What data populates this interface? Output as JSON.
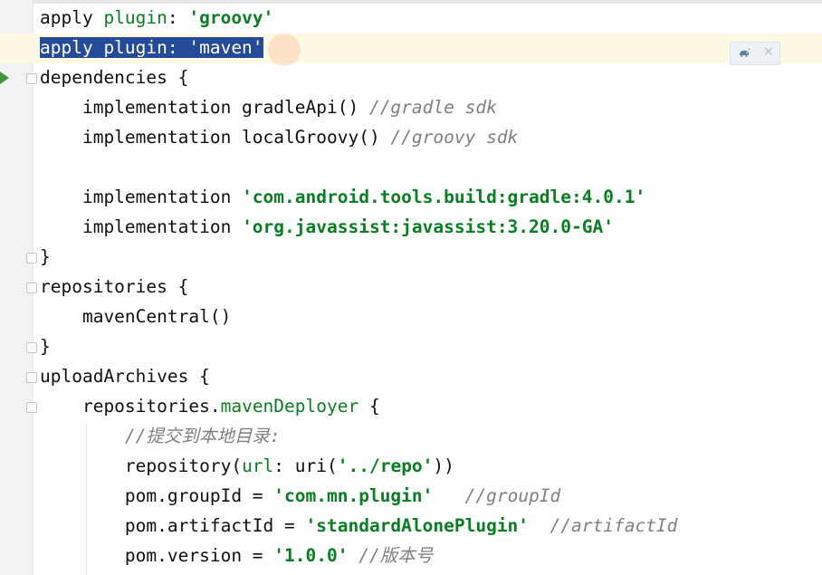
{
  "lines": [
    {
      "tokens": [
        {
          "t": "apply ",
          "c": "kw"
        },
        {
          "t": "plugin",
          "c": "dsl"
        },
        {
          "t": ": ",
          "c": "kw"
        },
        {
          "t": "'groovy'",
          "c": "str"
        }
      ]
    },
    {
      "tokens": [
        {
          "t": "apply plugin: 'maven'",
          "c": "sel"
        }
      ]
    },
    {
      "tokens": [
        {
          "t": "dependencies {",
          "c": "kw"
        }
      ]
    },
    {
      "tokens": [
        {
          "t": "    implementation gradleApi() ",
          "c": "kw"
        },
        {
          "t": "//gradle sdk",
          "c": "cmt"
        }
      ]
    },
    {
      "tokens": [
        {
          "t": "    implementation localGroovy() ",
          "c": "kw"
        },
        {
          "t": "//groovy sdk",
          "c": "cmt"
        }
      ]
    },
    {
      "tokens": []
    },
    {
      "tokens": [
        {
          "t": "    implementation ",
          "c": "kw"
        },
        {
          "t": "'com.android.tools.build:gradle:4.0.1'",
          "c": "str"
        }
      ]
    },
    {
      "tokens": [
        {
          "t": "    implementation ",
          "c": "kw"
        },
        {
          "t": "'org.javassist:javassist:3.20.0-GA'",
          "c": "str"
        }
      ]
    },
    {
      "tokens": [
        {
          "t": "}",
          "c": "kw"
        }
      ]
    },
    {
      "tokens": [
        {
          "t": "repositories {",
          "c": "kw"
        }
      ]
    },
    {
      "tokens": [
        {
          "t": "    mavenCentral()",
          "c": "kw"
        }
      ]
    },
    {
      "tokens": [
        {
          "t": "}",
          "c": "kw"
        }
      ]
    },
    {
      "tokens": [
        {
          "t": "uploadArchives {",
          "c": "kw"
        }
      ]
    },
    {
      "tokens": [
        {
          "t": "    repositories.",
          "c": "kw"
        },
        {
          "t": "mavenDeployer",
          "c": "dsl"
        },
        {
          "t": " {",
          "c": "kw"
        }
      ]
    },
    {
      "tokens": [
        {
          "t": "        ",
          "c": "kw"
        },
        {
          "t": "//提交到本地目录:",
          "c": "cmt"
        }
      ]
    },
    {
      "tokens": [
        {
          "t": "        repository(",
          "c": "kw"
        },
        {
          "t": "url",
          "c": "dsl"
        },
        {
          "t": ": uri(",
          "c": "kw"
        },
        {
          "t": "'../repo'",
          "c": "str"
        },
        {
          "t": "))",
          "c": "kw"
        }
      ]
    },
    {
      "tokens": [
        {
          "t": "        pom.groupId = ",
          "c": "kw"
        },
        {
          "t": "'com.mn.plugin'",
          "c": "str"
        },
        {
          "t": "   ",
          "c": "kw"
        },
        {
          "t": "//groupId",
          "c": "cmt"
        }
      ]
    },
    {
      "tokens": [
        {
          "t": "        pom.artifactId = ",
          "c": "kw"
        },
        {
          "t": "'standardAlonePlugin'",
          "c": "str"
        },
        {
          "t": "  ",
          "c": "kw"
        },
        {
          "t": "//artifactId",
          "c": "cmt"
        }
      ]
    },
    {
      "tokens": [
        {
          "t": "        pom.version = ",
          "c": "kw"
        },
        {
          "t": "'1.0.0'",
          "c": "str"
        },
        {
          "t": " ",
          "c": "kw"
        },
        {
          "t": "//版本号",
          "c": "cmt"
        }
      ]
    }
  ],
  "popup": {
    "gradle_icon": "gradle-elephant-icon",
    "close_icon": "close-icon",
    "close_glyph": "×"
  },
  "colors": {
    "string": "#0a7e22",
    "comment": "#808080",
    "selection": "#244a98",
    "current_line": "#fdf9e5",
    "run_marker": "#3c9a3c"
  }
}
